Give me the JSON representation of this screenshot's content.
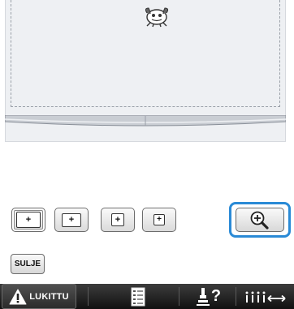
{
  "icons": {
    "motif": "embroidery-motif-icon",
    "frame_sizes": [
      "frame-extra-large-icon",
      "frame-large-icon",
      "frame-medium-icon",
      "frame-small-icon"
    ],
    "zoom": "magnifier-plus-icon",
    "lock": "warning-lock-icon",
    "checklist": "checklist-icon",
    "help": "presser-foot-help-icon",
    "thread": "thread-tension-icon"
  },
  "buttons": {
    "close_label": "SULJE"
  },
  "bottom_bar": {
    "lock_label": "LUKITTU",
    "help_mark": "?"
  },
  "colors": {
    "highlight": "#2a8ad6",
    "bar": "#1e1e1e",
    "warning": "#ffffff"
  }
}
